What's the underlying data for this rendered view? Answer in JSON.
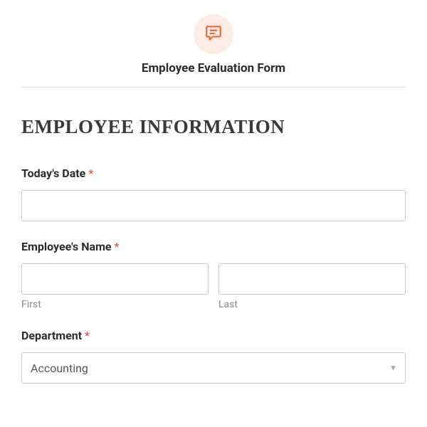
{
  "header": {
    "icon": "speech-bubble-icon",
    "title": "Employee Evaluation Form"
  },
  "section_heading": "EMPLOYEE INFORMATION",
  "fields": {
    "date": {
      "label": "Today's Date",
      "required_marker": "*",
      "value": ""
    },
    "name": {
      "label": "Employee's Name",
      "required_marker": "*",
      "first_sublabel": "First",
      "last_sublabel": "Last",
      "first_value": "",
      "last_value": ""
    },
    "department": {
      "label": "Department",
      "required_marker": "*",
      "selected": "Accounting"
    }
  },
  "colors": {
    "accent": "#e04e39",
    "icon_bg": "#fdece4"
  }
}
